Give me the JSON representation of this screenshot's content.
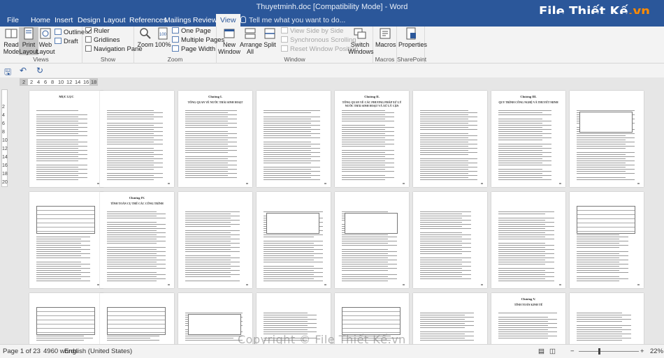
{
  "window": {
    "title": "Thuyetminh.doc [Compatibility Mode] - Word",
    "logo_text": "File Thiết Kế",
    "logo_suffix": ".vn"
  },
  "tabs": [
    "File",
    "Home",
    "Insert",
    "Design",
    "Layout",
    "References",
    "Mailings",
    "Review",
    "View"
  ],
  "active_tab": "View",
  "tell_me": "Tell me what you want to do...",
  "ribbon": {
    "views": {
      "read_mode": "Read Mode",
      "print_layout": "Print Layout",
      "web_layout": "Web Layout",
      "outline": "Outline",
      "draft": "Draft",
      "label": "Views"
    },
    "show": {
      "ruler": "Ruler",
      "ruler_checked": true,
      "gridlines": "Gridlines",
      "gridlines_checked": false,
      "nav_pane": "Navigation Pane",
      "nav_pane_checked": false,
      "label": "Show"
    },
    "zoom": {
      "zoom": "Zoom",
      "hundred": "100%",
      "one_page": "One Page",
      "multiple_pages": "Multiple Pages",
      "page_width": "Page Width",
      "label": "Zoom"
    },
    "window": {
      "new_window": "New Window",
      "arrange_all": "Arrange All",
      "split": "Split",
      "side_by_side": "View Side by Side",
      "sync_scroll": "Synchronous Scrolling",
      "reset_pos": "Reset Window Position",
      "switch_windows": "Switch Windows",
      "label": "Window"
    },
    "macros": {
      "macros": "Macros",
      "label": "Macros"
    },
    "sharepoint": {
      "properties": "Properties",
      "label": "SharePoint"
    }
  },
  "ruler_numbers": [
    "2",
    "2",
    "4",
    "6",
    "8",
    "10",
    "12",
    "14",
    "16",
    "18"
  ],
  "vruler_numbers": [
    "2",
    "4",
    "6",
    "8",
    "10",
    "12",
    "14",
    "16",
    "18",
    "20",
    "22",
    "24"
  ],
  "pages": {
    "row1": [
      "MỤC LỤC",
      "",
      "Chương I.",
      "",
      "Chương II.",
      "",
      "Chương III.",
      ""
    ],
    "row1_subtitles": [
      "",
      "",
      "TỔNG QUAN VỀ NƯỚC THẢI SINH HOẠT",
      "",
      "TỔNG QUAN VỀ CÁC PHƯƠNG PHÁP XỬ LÝ NƯỚC THẢI SINH HOẠT VÀ XỬ LÝ CẶN",
      "",
      "QUY TRÌNH CÔNG NGHỆ VÀ THUYẾT MINH",
      ""
    ],
    "row2_titles": [
      "",
      "Chương IV.",
      "",
      "",
      "",
      "",
      "",
      ""
    ],
    "row2_subtitles": [
      "",
      "TÍNH TOÁN CỤ THỂ CÁC CÔNG TRÌNH",
      "",
      "",
      "",
      "",
      "",
      ""
    ],
    "row3_titles": [
      "",
      "",
      "",
      "",
      "",
      "",
      "Chương V.",
      ""
    ],
    "row3_subtitles": [
      "",
      "",
      "",
      "",
      "",
      "",
      "TÍNH TOÁN KINH TẾ",
      ""
    ]
  },
  "status": {
    "page": "Page 1 of 23",
    "words": "4960 words",
    "language": "English (United States)",
    "zoom": "22%"
  },
  "watermark": "Copyright © File Thiết Kế.vn"
}
